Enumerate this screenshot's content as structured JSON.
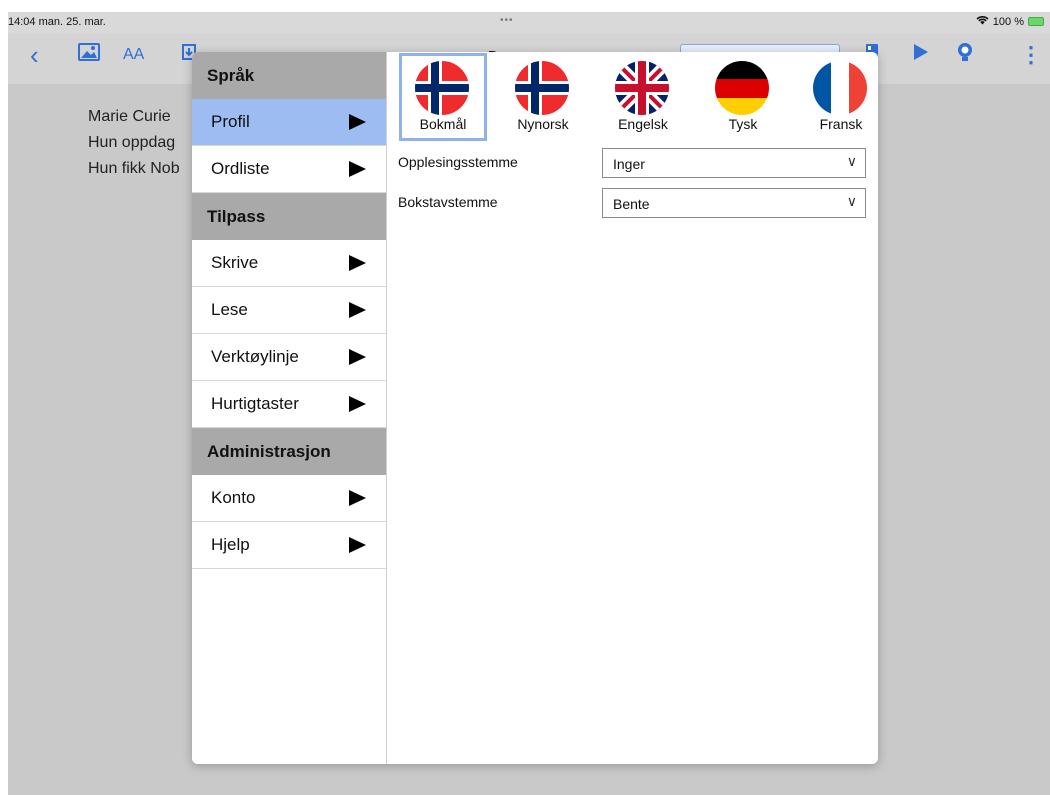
{
  "status_bar": {
    "time": "14:04  man. 25. mar.",
    "center_dots": "•••",
    "battery": "100 %"
  },
  "toolbar": {
    "back_icon": "chevron-left-icon",
    "image_icon": "image-icon",
    "text_size_label": "AA",
    "title_fragment": "D",
    "play_icon": "play-icon",
    "bulb_icon": "lightbulb-icon",
    "more_icon": "more-vertical-icon"
  },
  "document": {
    "lines": [
      "Marie Curie",
      "Hun oppdag",
      "Hun fikk Nob"
    ]
  },
  "sidebar": {
    "sections": [
      {
        "title": "Språk",
        "items": [
          {
            "label": "Profil",
            "active": true
          },
          {
            "label": "Ordliste",
            "active": false
          }
        ]
      },
      {
        "title": "Tilpass",
        "items": [
          {
            "label": "Skrive",
            "active": false
          },
          {
            "label": "Lese",
            "active": false
          },
          {
            "label": "Verktøylinje",
            "active": false
          },
          {
            "label": "Hurtigtaster",
            "active": false
          }
        ]
      },
      {
        "title": "Administrasjon",
        "items": [
          {
            "label": "Konto",
            "active": false
          },
          {
            "label": "Hjelp",
            "active": false
          }
        ]
      }
    ]
  },
  "languages": [
    {
      "label": "Bokmål",
      "flag": "norway-flag-icon",
      "selected": true
    },
    {
      "label": "Nynorsk",
      "flag": "norway-flag-icon",
      "selected": false
    },
    {
      "label": "Engelsk",
      "flag": "uk-flag-icon",
      "selected": false
    },
    {
      "label": "Tysk",
      "flag": "germany-flag-icon",
      "selected": false
    },
    {
      "label": "Fransk",
      "flag": "france-flag-icon",
      "selected": false
    }
  ],
  "settings": {
    "reading_voice": {
      "label": "Opplesingsstemme",
      "value": "Inger"
    },
    "letter_voice": {
      "label": "Bokstavstemme",
      "value": "Bente"
    }
  },
  "colors": {
    "accent": "#2f6fd6",
    "active_item": "#9cbcf2",
    "section_header": "#a9a9a9"
  }
}
